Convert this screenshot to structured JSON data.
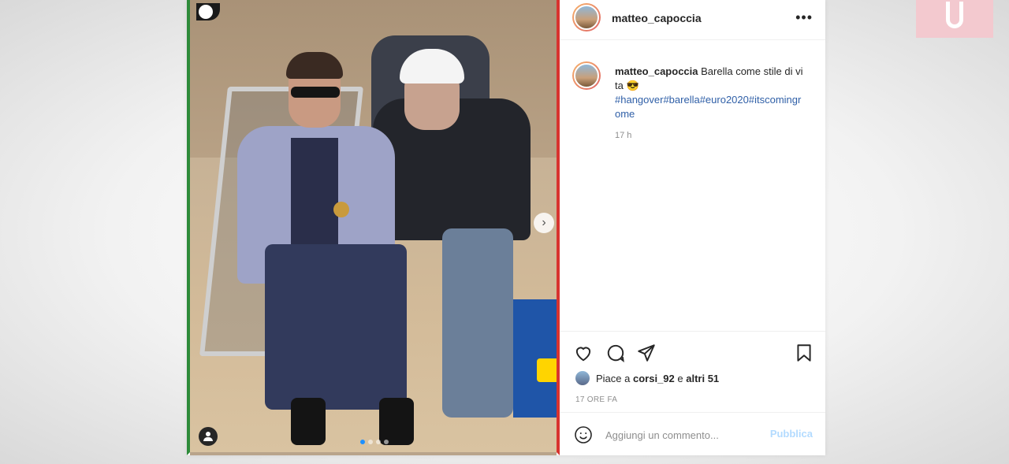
{
  "post": {
    "author": "matteo_capoccia",
    "more_icon": "more-horizontal-icon",
    "caption": {
      "username": "matteo_capoccia",
      "text": "Barella come stile di vita 😎",
      "hashtags": "#hangover#barella#euro2020#itscomingrome",
      "time": "17 h"
    },
    "likes": {
      "prefix": "Piace a",
      "user": "corsi_92",
      "connector": "e",
      "others": "altri 51"
    },
    "date": "17 ORE FA",
    "comment_placeholder": "Aggiungi un commento...",
    "publish_label": "Pubblica"
  },
  "photo": {
    "carousel_total": 4,
    "carousel_active": 1
  },
  "icons": {
    "like": "heart-icon",
    "comment": "comment-icon",
    "share": "paper-plane-icon",
    "save": "bookmark-icon",
    "emoji": "emoji-icon",
    "next": "chevron-right-icon",
    "tag": "user-tag-icon"
  },
  "colors": {
    "hashtag": "#2f5fa7",
    "publish_disabled": "#b3dbff",
    "flag_green": "#2e8b3a",
    "flag_red": "#d8332f",
    "carousel_active": "#1e90ff"
  }
}
